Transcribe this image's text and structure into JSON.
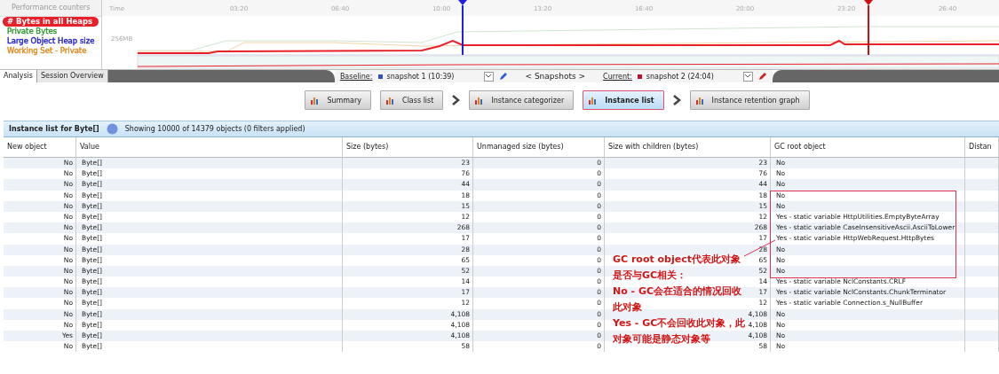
{
  "counters": {
    "title": "Performance counters",
    "items": [
      {
        "label": "# Bytes in all Heaps",
        "color": "#e8202a",
        "selected": true
      },
      {
        "label": "Private Bytes",
        "color": "#2e9a2e",
        "selected": false
      },
      {
        "label": "Large Object Heap size",
        "color": "#2020d0",
        "selected": false
      },
      {
        "label": "Working Set - Private",
        "color": "#e08a20",
        "selected": false
      }
    ]
  },
  "timeline": {
    "axis_label": "Time",
    "y_label": "256MB",
    "ticks": [
      "03:20",
      "06:40",
      "10:00",
      "13:20",
      "16:40",
      "20:00",
      "23:20",
      "26:40"
    ]
  },
  "tabs": [
    {
      "label": "Analysis",
      "selected": true
    },
    {
      "label": "Session Overview",
      "selected": false
    }
  ],
  "snapshots": {
    "baseline_label": "Baseline:",
    "baseline": "snapshot 1 (10:39)",
    "nav": "< Snapshots >",
    "current_label": "Current:",
    "current": "snapshot 2 (24:04)"
  },
  "views": [
    {
      "label": "Summary",
      "selected": false,
      "separator_after": false
    },
    {
      "label": "Class list",
      "selected": false,
      "separator_after": true
    },
    {
      "label": "Instance categorizer",
      "selected": false,
      "separator_after": false
    },
    {
      "label": "Instance list",
      "selected": true,
      "separator_after": true
    },
    {
      "label": "Instance retention graph",
      "selected": false,
      "separator_after": false
    }
  ],
  "info_bar": {
    "title": "Instance list for Byte[]",
    "status": "Showing 10000 of 14379 objects (0 filters applied)"
  },
  "table": {
    "columns": [
      "New object",
      "Value",
      "Size (bytes)",
      "Unmanaged size (bytes)",
      "Size with children (bytes)",
      "GC root object",
      "Distan"
    ],
    "rows": [
      [
        "No",
        "Byte[]",
        "23",
        "0",
        "23",
        "No"
      ],
      [
        "No",
        "Byte[]",
        "76",
        "0",
        "76",
        "No"
      ],
      [
        "No",
        "Byte[]",
        "44",
        "0",
        "44",
        "No"
      ],
      [
        "No",
        "Byte[]",
        "18",
        "0",
        "18",
        "No"
      ],
      [
        "No",
        "Byte[]",
        "15",
        "0",
        "15",
        "No"
      ],
      [
        "No",
        "Byte[]",
        "12",
        "0",
        "12",
        "Yes - static variable HttpUtilities.EmptyByteArray"
      ],
      [
        "No",
        "Byte[]",
        "268",
        "0",
        "268",
        "Yes - static variable CaseInsensitiveAscii.AsciiToLower"
      ],
      [
        "No",
        "Byte[]",
        "17",
        "0",
        "17",
        "Yes - static variable HttpWebRequest.HttpBytes"
      ],
      [
        "No",
        "Byte[]",
        "28",
        "0",
        "28",
        "No"
      ],
      [
        "No",
        "Byte[]",
        "65",
        "0",
        "65",
        "No"
      ],
      [
        "No",
        "Byte[]",
        "52",
        "0",
        "52",
        "No"
      ],
      [
        "No",
        "Byte[]",
        "14",
        "0",
        "14",
        "Yes - static variable NclConstants.CRLF"
      ],
      [
        "No",
        "Byte[]",
        "17",
        "0",
        "17",
        "Yes - static variable NclConstants.ChunkTerminator"
      ],
      [
        "No",
        "Byte[]",
        "12",
        "0",
        "12",
        "Yes - static variable Connection.s_NullBuffer"
      ],
      [
        "No",
        "Byte[]",
        "4,108",
        "0",
        "4,108",
        "No"
      ],
      [
        "No",
        "Byte[]",
        "4,108",
        "0",
        "4,108",
        "No"
      ],
      [
        "Yes",
        "Byte[]",
        "4,108",
        "0",
        "4,108",
        "No"
      ],
      [
        "No",
        "Byte[]",
        "58",
        "0",
        "58",
        "No"
      ]
    ]
  },
  "annotation": {
    "lines": [
      "GC root object代表此对象是否与GC相关：",
      "No - GC会在适合的情况回收此对象",
      "Yes - GC不会回收此对象，此对象可能是静态对象等"
    ]
  }
}
